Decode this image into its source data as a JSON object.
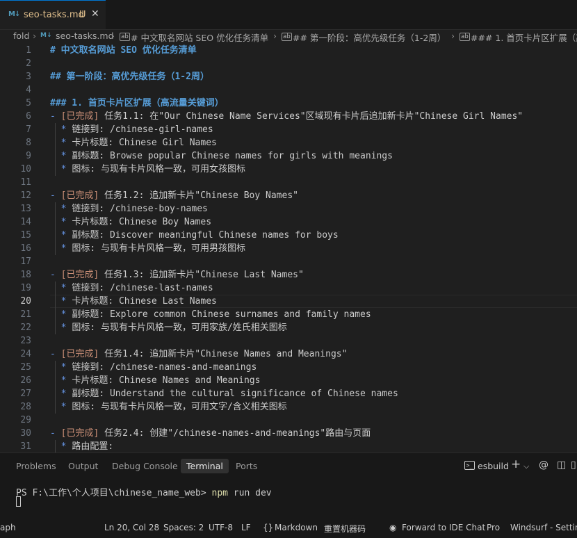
{
  "tab": {
    "icon": "markdown-icon",
    "icon_text": "M↓",
    "label": "seo-tasks.md",
    "status": "U",
    "close": "✕"
  },
  "breadcrumb": {
    "folder": "fold",
    "file": "seo-tasks.md",
    "h1": "# 中文取名网站 SEO 优化任务清单",
    "h2": "## 第一阶段：高优先级任务（1-2周）",
    "h3": "### 1. 首页卡片区扩展（高"
  },
  "editor": {
    "active_line": 20,
    "lines": [
      {
        "n": "1",
        "t": "# 中文取名网站 SEO 优化任务清单",
        "k": "hdr"
      },
      {
        "n": "2",
        "t": "",
        "k": "plain"
      },
      {
        "n": "3",
        "t": "## 第一阶段：高优先级任务（1-2周）",
        "k": "hdr"
      },
      {
        "n": "4",
        "t": "",
        "k": "plain"
      },
      {
        "n": "5",
        "t": "### 1. 首页卡片区扩展（高流量关键词）",
        "k": "hdr"
      },
      {
        "n": "6",
        "b": "- ",
        "s": "[已完成]",
        "t": " 任务1.1: 在\"Our Chinese Name Services\"区域现有卡片后追加新卡片\"Chinese Girl Names\"",
        "k": "task"
      },
      {
        "n": "7",
        "b": "  * ",
        "t": "链接到: /chinese-girl-names",
        "k": "sub"
      },
      {
        "n": "8",
        "b": "  * ",
        "t": "卡片标题: Chinese Girl Names",
        "k": "sub"
      },
      {
        "n": "9",
        "b": "  * ",
        "t": "副标题: Browse popular Chinese names for girls with meanings",
        "k": "sub"
      },
      {
        "n": "10",
        "b": "  * ",
        "t": "图标: 与现有卡片风格一致，可用女孩图标",
        "k": "sub"
      },
      {
        "n": "11",
        "t": "",
        "k": "plain"
      },
      {
        "n": "12",
        "b": "- ",
        "s": "[已完成]",
        "t": " 任务1.2: 追加新卡片\"Chinese Boy Names\"",
        "k": "task"
      },
      {
        "n": "13",
        "b": "  * ",
        "t": "链接到: /chinese-boy-names",
        "k": "sub"
      },
      {
        "n": "14",
        "b": "  * ",
        "t": "卡片标题: Chinese Boy Names",
        "k": "sub"
      },
      {
        "n": "15",
        "b": "  * ",
        "t": "副标题: Discover meaningful Chinese names for boys",
        "k": "sub"
      },
      {
        "n": "16",
        "b": "  * ",
        "t": "图标: 与现有卡片风格一致，可用男孩图标",
        "k": "sub"
      },
      {
        "n": "17",
        "t": "",
        "k": "plain"
      },
      {
        "n": "18",
        "b": "- ",
        "s": "[已完成]",
        "t": " 任务1.3: 追加新卡片\"Chinese Last Names\"",
        "k": "task"
      },
      {
        "n": "19",
        "b": "  * ",
        "t": "链接到: /chinese-last-names",
        "k": "sub"
      },
      {
        "n": "20",
        "b": "  * ",
        "t": "卡片标题: Chinese Last Names",
        "k": "sub"
      },
      {
        "n": "21",
        "b": "  * ",
        "t": "副标题: Explore common Chinese surnames and family names",
        "k": "sub"
      },
      {
        "n": "22",
        "b": "  * ",
        "t": "图标: 与现有卡片风格一致，可用家族/姓氏相关图标",
        "k": "sub"
      },
      {
        "n": "23",
        "t": "",
        "k": "plain"
      },
      {
        "n": "24",
        "b": "- ",
        "s": "[已完成]",
        "t": " 任务1.4: 追加新卡片\"Chinese Names and Meanings\"",
        "k": "task"
      },
      {
        "n": "25",
        "b": "  * ",
        "t": "链接到: /chinese-names-and-meanings",
        "k": "sub"
      },
      {
        "n": "26",
        "b": "  * ",
        "t": "卡片标题: Chinese Names and Meanings",
        "k": "sub"
      },
      {
        "n": "27",
        "b": "  * ",
        "t": "副标题: Understand the cultural significance of Chinese names",
        "k": "sub"
      },
      {
        "n": "28",
        "b": "  * ",
        "t": "图标: 与现有卡片风格一致，可用文字/含义相关图标",
        "k": "sub"
      },
      {
        "n": "29",
        "t": "",
        "k": "plain"
      },
      {
        "n": "30",
        "b": "- ",
        "s": "[已完成]",
        "t": " 任务2.4: 创建\"/chinese-names-and-meanings\"路由与页面",
        "k": "task"
      },
      {
        "n": "31",
        "b": "  * ",
        "t": "路由配置:",
        "k": "sub"
      }
    ]
  },
  "panel": {
    "tabs": [
      "Problems",
      "Output",
      "Debug Console",
      "Terminal",
      "Ports"
    ],
    "active_tab": "Terminal",
    "terminal_name": "esbuild",
    "terminal_icon": "terminal-icon",
    "tools": [
      "+",
      "⌵",
      "@",
      "◫",
      "▯"
    ],
    "prompt": "PS F:\\工作\\个人项目\\chinese_name_web> ",
    "command": "npm run dev",
    "args": " run dev",
    "cmd_head": "npm"
  },
  "statusbar": {
    "left": "aph",
    "position": "Ln 20, Col 28",
    "spaces": "Spaces: 2",
    "encoding": "UTF-8",
    "eol": "LF",
    "language": "Markdown",
    "extra": "重置机器码",
    "chat": "Forward to IDE Chat",
    "pro": "Pro",
    "windsurf": "Windsurf - Setting"
  },
  "colors": {
    "accent": "#0078d4",
    "heading": "#569cd6",
    "done": "#ce9178",
    "modified": "#e2c08d",
    "command": "#dcdcaa"
  }
}
